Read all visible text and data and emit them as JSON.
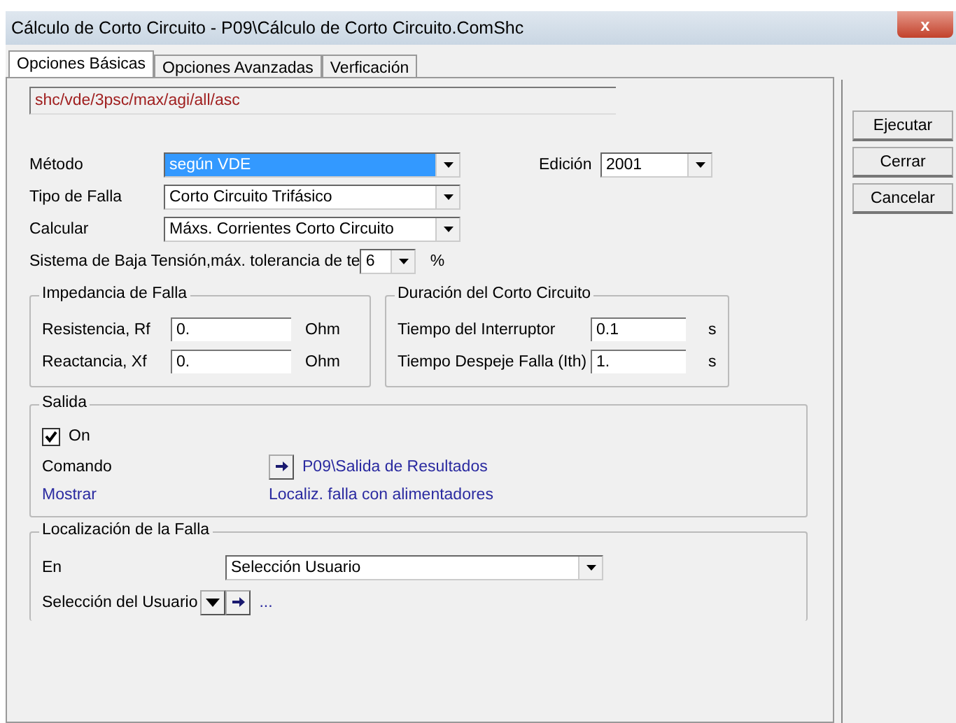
{
  "window": {
    "title": "Cálculo de Corto Circuito - P09\\Cálculo de Corto Circuito.ComShc",
    "close": "x"
  },
  "tabs": [
    {
      "label": "Opciones Básicas",
      "selected": true
    },
    {
      "label": "Opciones Avanzadas",
      "selected": false
    },
    {
      "label": "Verficación",
      "selected": false
    }
  ],
  "path": "shc/vde/3psc/max/agi/all/asc",
  "method": {
    "label": "Método",
    "value": "según VDE",
    "selected": true,
    "edition_label": "Edición",
    "edition": "2001"
  },
  "fault_type": {
    "label": "Tipo de Falla",
    "value": "Corto Circuito Trifásico"
  },
  "calculate": {
    "label": "Calcular",
    "value": "Máxs. Corrientes Corto Circuito"
  },
  "low_voltage": {
    "label": "Sistema de Baja Tensión,máx. tolerancia de te",
    "value": "6",
    "unit": "%"
  },
  "impedance": {
    "title": "Impedancia de Falla",
    "rows": [
      {
        "label": "Resistencia, Rf",
        "value": "0.",
        "unit": "Ohm"
      },
      {
        "label": "Reactancia, Xf",
        "value": "0.",
        "unit": "Ohm"
      }
    ]
  },
  "duration": {
    "title": "Duración del Corto Circuito",
    "rows": [
      {
        "label": "Tiempo del Interruptor",
        "value": "0.1",
        "unit": "s"
      },
      {
        "label": "Tiempo Despeje Falla (Ith)",
        "value": "1.",
        "unit": "s"
      }
    ]
  },
  "output": {
    "title": "Salida",
    "on_label": "On",
    "checked": true,
    "command_label": "Comando",
    "command": "P09\\Salida de Resultados",
    "show_label": "Mostrar",
    "show": "Localiz. falla con alimentadores"
  },
  "location": {
    "title": "Localización de la Falla",
    "at_label": "En",
    "at": "Selección Usuario",
    "user_label": "Selección del Usuario",
    "user_value": "..."
  },
  "buttons": [
    "Ejecutar",
    "Cerrar",
    "Cancelar"
  ]
}
